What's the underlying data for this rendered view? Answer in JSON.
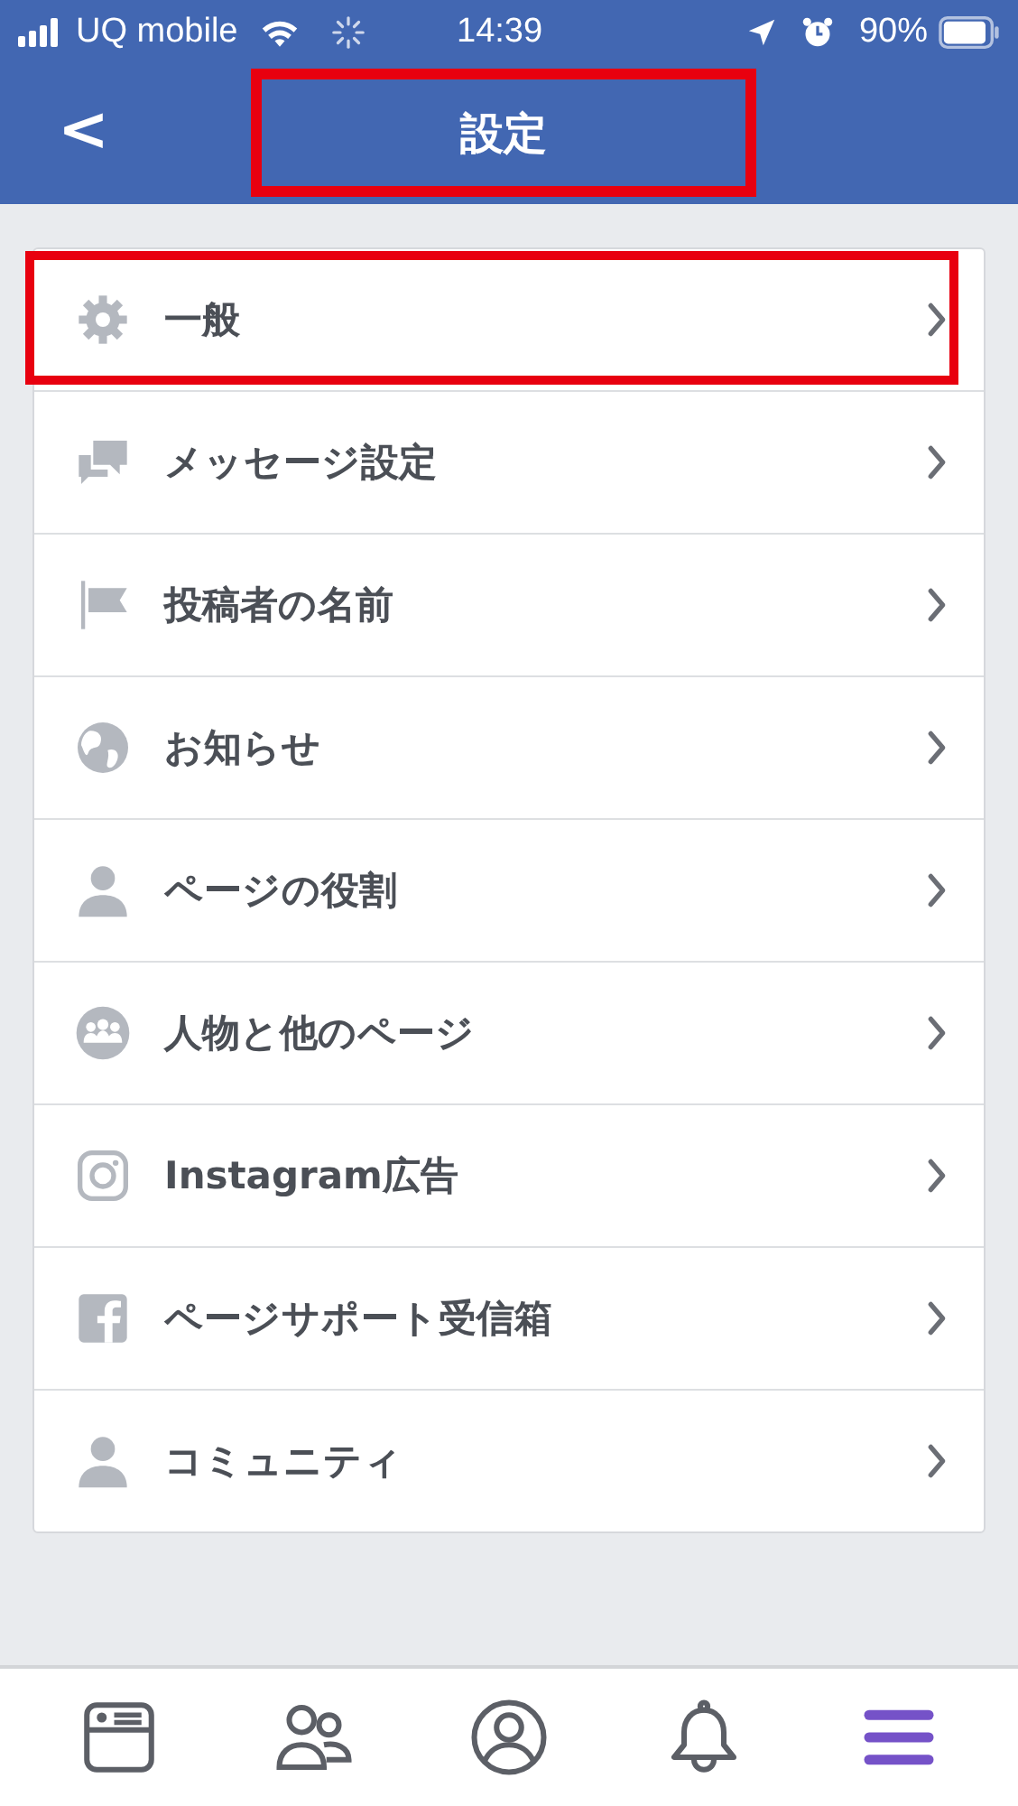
{
  "status_bar": {
    "carrier": "UQ mobile",
    "time": "14:39",
    "battery": "90%"
  },
  "header": {
    "back": "<",
    "title": "設定",
    "highlighted": true
  },
  "items": [
    {
      "label": "一般",
      "kind": "gear",
      "highlighted": true
    },
    {
      "label": "メッセージ設定",
      "kind": "chat",
      "highlighted": false
    },
    {
      "label": "投稿者の名前",
      "kind": "flag",
      "highlighted": false
    },
    {
      "label": "お知らせ",
      "kind": "globe",
      "highlighted": false
    },
    {
      "label": "ページの役割",
      "kind": "person",
      "highlighted": false
    },
    {
      "label": "人物と他のページ",
      "kind": "group",
      "highlighted": false
    },
    {
      "label": "Instagram広告",
      "kind": "instagram",
      "highlighted": false
    },
    {
      "label": "ページサポート受信箱",
      "kind": "facebook",
      "highlighted": false
    },
    {
      "label": "コミュニティ",
      "kind": "person",
      "highlighted": false
    }
  ],
  "tab_bar": [
    {
      "kind": "feed",
      "selected": false
    },
    {
      "kind": "friends",
      "selected": false
    },
    {
      "kind": "profile",
      "selected": false
    },
    {
      "kind": "notifications",
      "selected": false
    },
    {
      "kind": "menu",
      "selected": true
    }
  ]
}
